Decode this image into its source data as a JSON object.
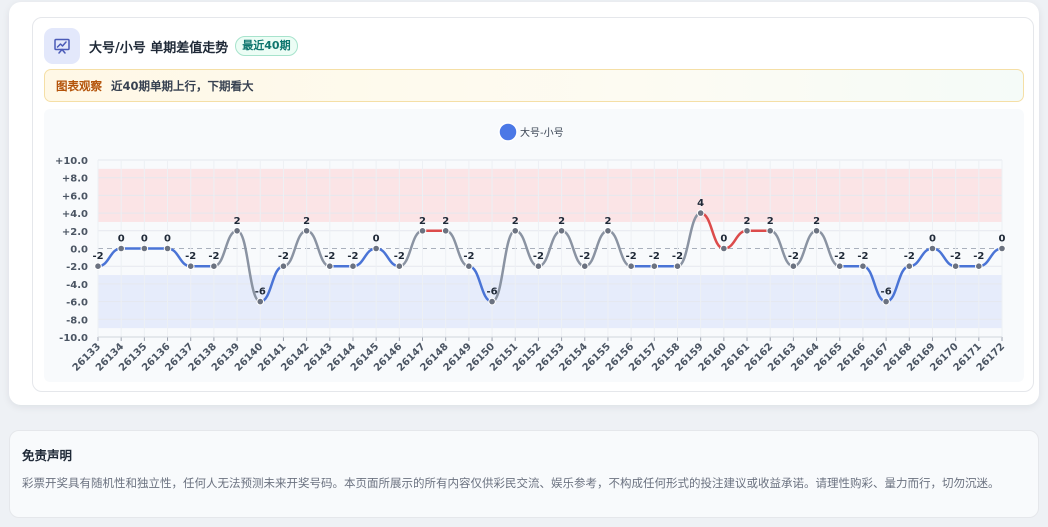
{
  "header": {
    "title": "大号/小号 单期差值走势",
    "badge": "最近40期",
    "icon": "chart-presentation-icon"
  },
  "insight": {
    "tag": "图表观察",
    "text": "近40期单期上行，下期看大"
  },
  "disclaimer": {
    "title": "免责声明",
    "text": "彩票开奖具有随机性和独立性，任何人无法预测未来开奖号码。本页面所展示的所有内容仅供彩民交流、娱乐参考，不构成任何形式的投注建议或收益承诺。请理性购彩、量力而行，切勿沉迷。"
  },
  "chart_data": {
    "type": "line",
    "series": [
      {
        "name": "大号-小号",
        "values": [
          -2,
          0,
          0,
          0,
          -2,
          -2,
          2,
          -6,
          -2,
          2,
          -2,
          -2,
          0,
          -2,
          2,
          2,
          -2,
          -6,
          2,
          -2,
          2,
          -2,
          2,
          -2,
          -2,
          -2,
          4,
          0,
          2,
          2,
          -2,
          2,
          -2,
          -2,
          -6,
          -2,
          0,
          -2,
          -2,
          0
        ]
      }
    ],
    "categories": [
      "26133",
      "26134",
      "26135",
      "26136",
      "26137",
      "26138",
      "26139",
      "26140",
      "26141",
      "26142",
      "26143",
      "26144",
      "26145",
      "26146",
      "26147",
      "26148",
      "26149",
      "26150",
      "26151",
      "26152",
      "26153",
      "26154",
      "26155",
      "26156",
      "26157",
      "26158",
      "26159",
      "26160",
      "26161",
      "26162",
      "26163",
      "26164",
      "26165",
      "26166",
      "26167",
      "26168",
      "26169",
      "26170",
      "26171",
      "26172"
    ],
    "yticks": [
      "+10.0",
      "+8.0",
      "+6.0",
      "+4.0",
      "+2.0",
      "0.0",
      "-2.0",
      "-4.0",
      "-6.0",
      "-8.0",
      "-10.0"
    ],
    "ylim": [
      -10,
      10
    ],
    "bands": [
      {
        "from": 3,
        "to": 9,
        "color": "#fbe4e6"
      },
      {
        "from": -9,
        "to": -3,
        "color": "#e6ecfb"
      }
    ],
    "legend_position": "top-center",
    "grid": true,
    "colors": {
      "up": "#dc4b4b",
      "down": "#4a74d6",
      "flat": "#8a93a2",
      "marker": "#6b7280",
      "legend_marker": "#4b78e6",
      "zero_line": "#a9b0bc"
    }
  }
}
